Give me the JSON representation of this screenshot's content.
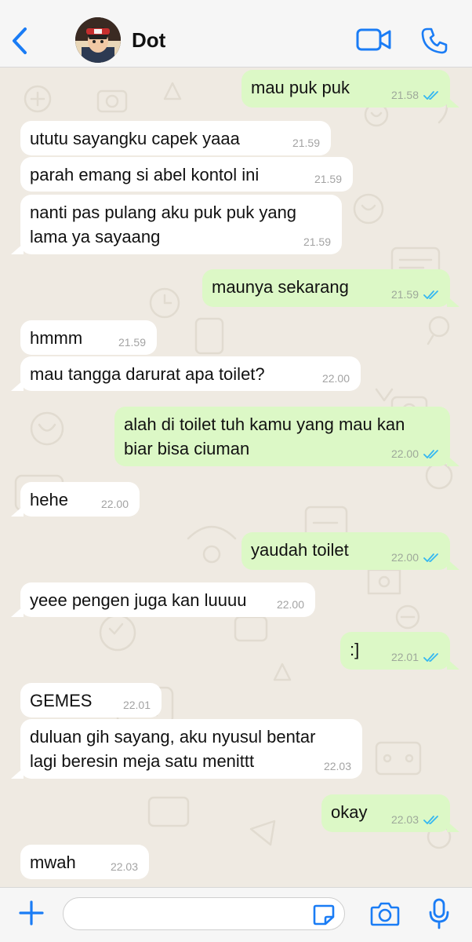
{
  "header": {
    "contact_name": "Dot",
    "icons": [
      "chevron-left-icon",
      "video-camera-icon",
      "phone-icon"
    ]
  },
  "colors": {
    "accent": "#1a7cf5",
    "incoming_bubble": "#ffffff",
    "outgoing_bubble": "#dcf8c6",
    "read_ticks": "#34b7f1",
    "wallpaper": "#efeae2"
  },
  "messages": [
    {
      "direction": "out",
      "text": "mau puk puk",
      "time": "21.58",
      "read": true
    },
    {
      "direction": "in",
      "text": "ututu sayangku capek yaaa",
      "time": "21.59"
    },
    {
      "direction": "in",
      "text": "parah emang si abel kontol ini",
      "time": "21.59"
    },
    {
      "direction": "in",
      "text": "nanti pas pulang aku puk puk yang\nlama ya sayaang",
      "time": "21.59"
    },
    {
      "direction": "out",
      "text": "maunya sekarang",
      "time": "21.59",
      "read": true
    },
    {
      "direction": "in",
      "text": "hmmm",
      "time": "21.59"
    },
    {
      "direction": "in",
      "text": "mau tangga darurat apa toilet?",
      "time": "22.00"
    },
    {
      "direction": "out",
      "text": "alah di toilet tuh kamu yang mau kan\nbiar bisa ciuman",
      "time": "22.00",
      "read": true
    },
    {
      "direction": "in",
      "text": "hehe",
      "time": "22.00"
    },
    {
      "direction": "out",
      "text": "yaudah toilet",
      "time": "22.00",
      "read": true
    },
    {
      "direction": "in",
      "text": "yeee pengen juga kan luuuu",
      "time": "22.00"
    },
    {
      "direction": "out",
      "text": ":]",
      "time": "22.01",
      "read": true
    },
    {
      "direction": "in",
      "text": "GEMES",
      "time": "22.01"
    },
    {
      "direction": "in",
      "text": "duluan gih sayang, aku nyusul bentar\nlagi beresin meja satu menittt",
      "time": "22.03"
    },
    {
      "direction": "out",
      "text": "okay",
      "time": "22.03",
      "read": true
    },
    {
      "direction": "in",
      "text": "mwah",
      "time": "22.03"
    }
  ],
  "composer": {
    "input_value": "",
    "icons": [
      "plus-icon",
      "sticker-icon",
      "camera-icon",
      "microphone-icon"
    ]
  }
}
